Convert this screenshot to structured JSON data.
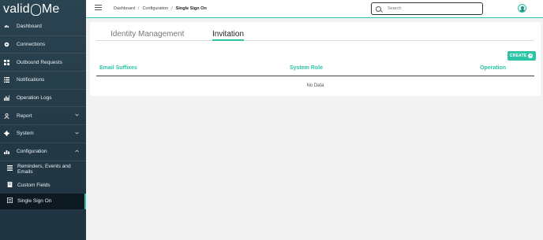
{
  "brand": {
    "left": "valid",
    "right": "Me",
    "accent": "#2ec4a6"
  },
  "sidebar": {
    "items": [
      {
        "label": "Dashboard",
        "icon": "dashboard-icon"
      },
      {
        "label": "Connections",
        "icon": "connections-icon"
      },
      {
        "label": "Outbound Requests",
        "icon": "grid-icon"
      },
      {
        "label": "Notifications",
        "icon": "list-icon"
      },
      {
        "label": "Operation Logs",
        "icon": "chart-icon"
      },
      {
        "label": "Report",
        "icon": "user-icon",
        "expandable": true
      },
      {
        "label": "System",
        "icon": "gear-icon",
        "expandable": true
      },
      {
        "label": "Configuration",
        "icon": "bar-chart-icon",
        "expandable": true,
        "expanded": true
      }
    ],
    "sub_items": [
      {
        "label": "Reminders, Events and Emails",
        "icon": "list-icon"
      },
      {
        "label": "Custom Fields",
        "icon": "field-icon"
      },
      {
        "label": "Single Sign On",
        "icon": "sso-icon",
        "active": true
      }
    ]
  },
  "header": {
    "breadcrumbs": [
      "Dashboard",
      "Configuration",
      "Single Sign On"
    ],
    "search_placeholder": "Search"
  },
  "main": {
    "tabs": [
      {
        "label": "Identity Management",
        "active": false
      },
      {
        "label": "Invitation",
        "active": true
      }
    ],
    "create_label": "CREATE",
    "table": {
      "columns": [
        "Email Suffixes",
        "System Role",
        "Operation"
      ],
      "rows": [],
      "empty_text": "No Data"
    }
  }
}
